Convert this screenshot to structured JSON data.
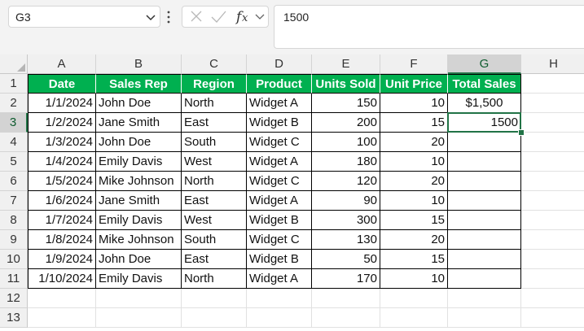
{
  "formula_bar": {
    "name_box": "G3",
    "formula": "1500"
  },
  "sheet": {
    "columns": [
      "A",
      "B",
      "C",
      "D",
      "E",
      "F",
      "G",
      "H"
    ],
    "rows": [
      "1",
      "2",
      "3",
      "4",
      "5",
      "6",
      "7",
      "8",
      "9",
      "10",
      "11",
      "12",
      "13"
    ],
    "selected_cell": "G3",
    "headers": [
      "Date",
      "Sales Rep",
      "Region",
      "Product",
      "Units Sold",
      "Unit Price",
      "Total Sales"
    ],
    "data": [
      [
        "1/1/2024",
        "John Doe",
        "North",
        "Widget A",
        "150",
        "10",
        "$1,500"
      ],
      [
        "1/2/2024",
        "Jane Smith",
        "East",
        "Widget B",
        "200",
        "15",
        "1500"
      ],
      [
        "1/3/2024",
        "John Doe",
        "South",
        "Widget C",
        "100",
        "20",
        ""
      ],
      [
        "1/4/2024",
        "Emily Davis",
        "West",
        "Widget A",
        "180",
        "10",
        ""
      ],
      [
        "1/5/2024",
        "Mike Johnson",
        "North",
        "Widget C",
        "120",
        "20",
        ""
      ],
      [
        "1/6/2024",
        "Jane Smith",
        "East",
        "Widget A",
        "90",
        "10",
        ""
      ],
      [
        "1/7/2024",
        "Emily Davis",
        "West",
        "Widget B",
        "300",
        "15",
        ""
      ],
      [
        "1/8/2024",
        "Mike Johnson",
        "South",
        "Widget C",
        "130",
        "20",
        ""
      ],
      [
        "1/9/2024",
        "John Doe",
        "East",
        "Widget B",
        "50",
        "15",
        ""
      ],
      [
        "1/10/2024",
        "Emily Davis",
        "North",
        "Widget A",
        "170",
        "10",
        ""
      ]
    ],
    "colors": {
      "header_fill": "#00b050",
      "header_text": "#ffffff",
      "selection": "#217346"
    }
  }
}
